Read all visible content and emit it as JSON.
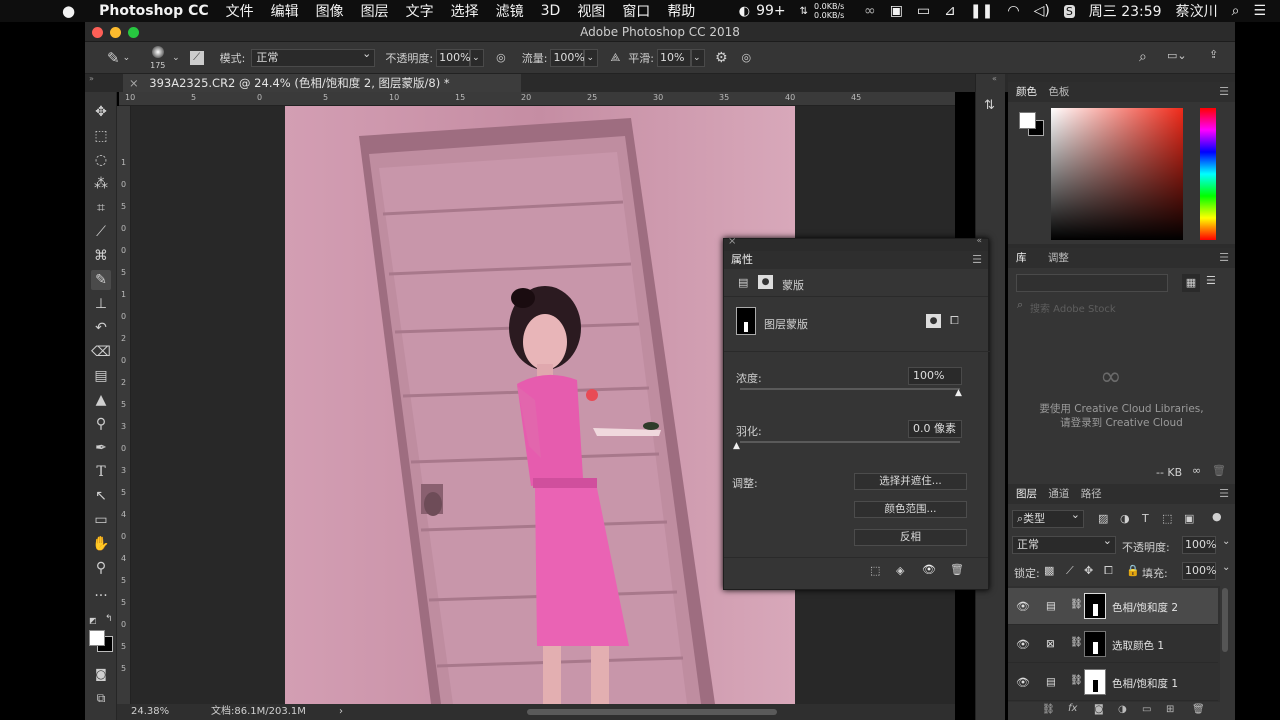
{
  "menubar": {
    "apple": "",
    "app": "Photoshop CC",
    "items": [
      "文件",
      "编辑",
      "图像",
      "图层",
      "文字",
      "选择",
      "滤镜",
      "3D",
      "视图",
      "窗口",
      "帮助"
    ],
    "badge": "99+",
    "net_up": "0.0KB/s",
    "net_down": "0.0KB/s",
    "datetime": "周三 23:59",
    "user": "蔡汶川"
  },
  "window": {
    "title": "Adobe Photoshop CC 2018"
  },
  "options": {
    "brush_size": "175",
    "mode_label": "模式:",
    "mode_value": "正常",
    "opacity_label": "不透明度:",
    "opacity_value": "100%",
    "flow_label": "流量:",
    "flow_value": "100%",
    "smooth_label": "平滑:",
    "smooth_value": "10%"
  },
  "doc": {
    "tab_title": "393A2325.CR2 @ 24.4% (色相/饱和度 2, 图层蒙版/8) *",
    "ruler_top": [
      "10",
      "5",
      "0",
      "5",
      "10",
      "15",
      "20",
      "25",
      "30",
      "35",
      "40",
      "45"
    ],
    "ruler_left": [
      "1",
      "0",
      "5",
      "0",
      "0",
      "5",
      "1",
      "0",
      "2",
      "0",
      "2",
      "5",
      "3",
      "0",
      "3",
      "5",
      "4",
      "0",
      "4",
      "5",
      "5",
      "0",
      "5",
      "5"
    ]
  },
  "status": {
    "zoom": "24.38%",
    "doc_size": "文档:86.1M/203.1M",
    "arrow": "›"
  },
  "color_panel": {
    "tabs": [
      "颜色",
      "色板"
    ]
  },
  "library_panel": {
    "tabs": [
      "库",
      "调整"
    ],
    "search_placeholder": "搜索 Adobe Stock",
    "message_line1": "要使用 Creative Cloud Libraries,",
    "message_line2": "请登录到 Creative Cloud",
    "size": "-- KB"
  },
  "properties": {
    "title": "属性",
    "mask_tab": "蒙版",
    "layer_mask": "图层蒙版",
    "density_label": "浓度:",
    "density_value": "100%",
    "feather_label": "羽化:",
    "feather_value": "0.0 像素",
    "adjust_label": "调整:",
    "btn_select_mask": "选择并遮住...",
    "btn_color_range": "颜色范围...",
    "btn_invert": "反相"
  },
  "layers_panel": {
    "tabs": [
      "图层",
      "通道",
      "路径"
    ],
    "filter_kind": "类型",
    "blend_mode": "正常",
    "opacity_label": "不透明度:",
    "opacity_value": "100%",
    "lock_label": "锁定:",
    "fill_label": "填充:",
    "fill_value": "100%",
    "layers": [
      {
        "name": "色相/饱和度 2",
        "selected": true
      },
      {
        "name": "选取颜色 1",
        "selected": false
      },
      {
        "name": "色相/饱和度 1",
        "selected": false
      }
    ]
  },
  "colors": {
    "menubar_bg": "#0e0e0e",
    "panel_bg": "#353535",
    "canvas_bg": "#282828",
    "wall": "#c88fa5",
    "dress": "#e85fb0",
    "traffic_close": "#fd5f57",
    "traffic_min": "#fdbb2e",
    "traffic_max": "#27c840"
  },
  "icons": {
    "move": "move-icon",
    "marquee": "marquee-icon",
    "lasso": "lasso-icon",
    "brush": "brush-icon"
  }
}
